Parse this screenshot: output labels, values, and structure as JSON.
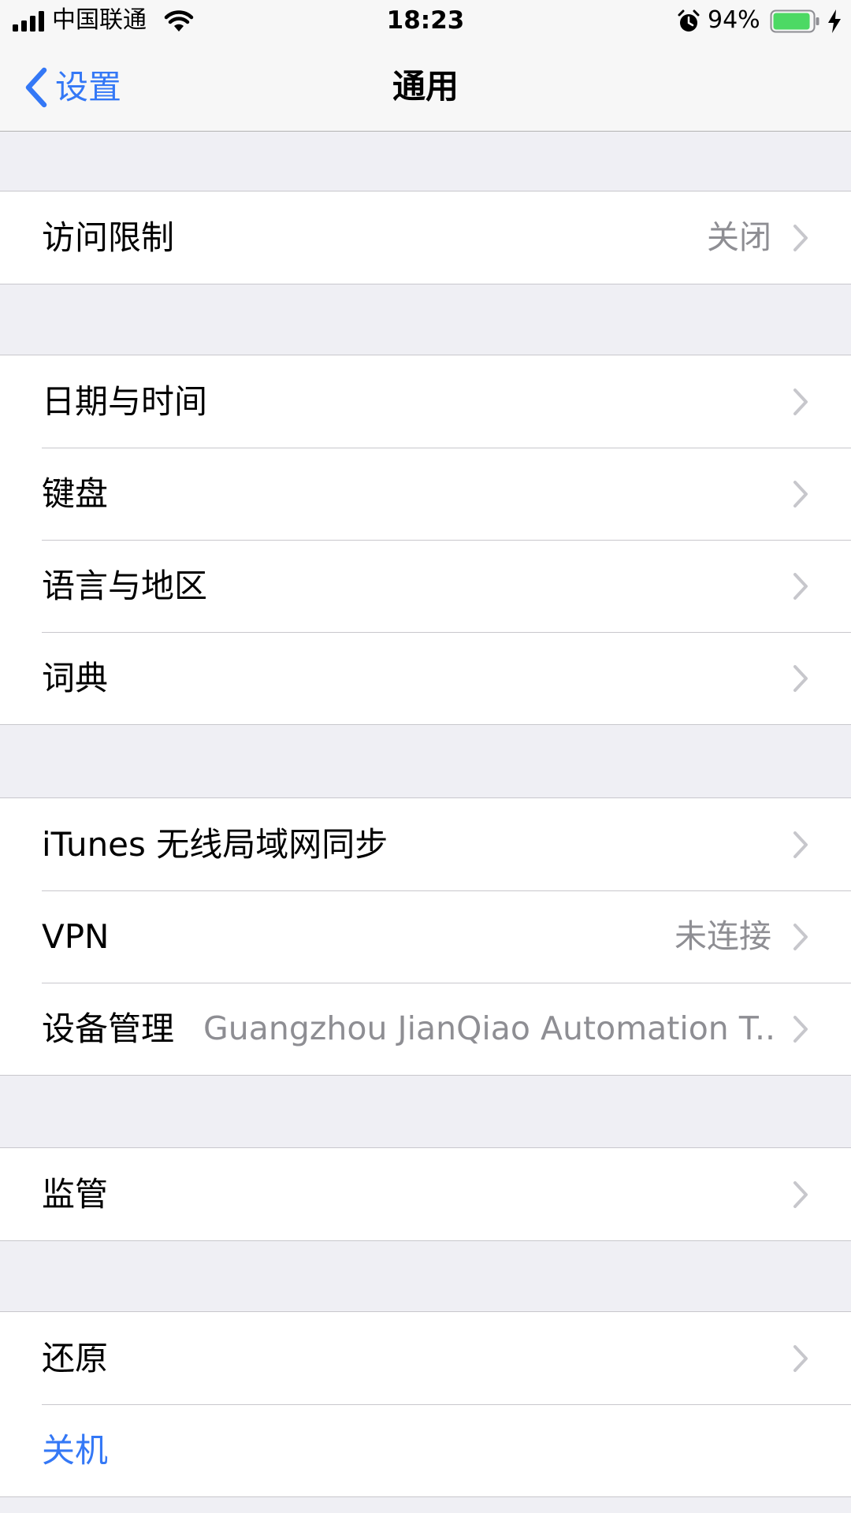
{
  "status_bar": {
    "carrier": "中国联通",
    "time": "18:23",
    "battery_percent": "94%",
    "battery_level": 0.94,
    "battery_color": "#4cd964",
    "icons": [
      "signal-icon",
      "wifi-icon",
      "alarm-icon",
      "battery-icon",
      "charging-bolt-icon"
    ]
  },
  "nav": {
    "back_label": "设置",
    "title": "通用"
  },
  "accent_color": "#3478f6",
  "groups": [
    {
      "rows": [
        {
          "label": "访问限制",
          "value": "关闭",
          "chevron": true
        }
      ]
    },
    {
      "rows": [
        {
          "label": "日期与时间",
          "chevron": true
        },
        {
          "label": "键盘",
          "chevron": true
        },
        {
          "label": "语言与地区",
          "chevron": true
        },
        {
          "label": "词典",
          "chevron": true
        }
      ]
    },
    {
      "rows": [
        {
          "label": "iTunes 无线局域网同步",
          "chevron": true
        },
        {
          "label": "VPN",
          "value": "未连接",
          "chevron": true
        },
        {
          "label": "设备管理",
          "value": "Guangzhou JianQiao Automation T...",
          "chevron": true
        }
      ]
    },
    {
      "rows": [
        {
          "label": "监管",
          "chevron": true
        }
      ]
    },
    {
      "rows": [
        {
          "label": "还原",
          "chevron": true
        },
        {
          "label": "关机",
          "chevron": false
        }
      ]
    }
  ]
}
